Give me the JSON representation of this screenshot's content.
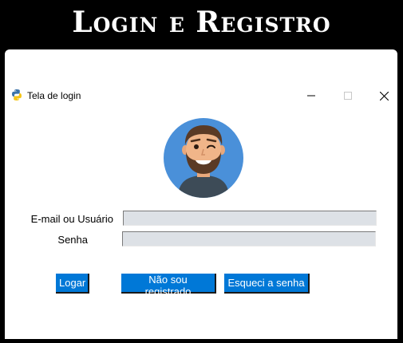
{
  "banner": {
    "title": "Login e Registro"
  },
  "window": {
    "title": "Tela de login",
    "app_icon": "python-icon",
    "controls": {
      "minimize_icon": "minimize-icon",
      "maximize_icon": "maximize-icon",
      "close_icon": "close-icon"
    }
  },
  "avatar": {
    "icon": "user-avatar-winking-bearded-man",
    "background_color": "#4a90d9"
  },
  "form": {
    "user_label": "E-mail ou Usuário",
    "user_value": "",
    "password_label": "Senha",
    "password_value": ""
  },
  "buttons": {
    "login_label": "Logar",
    "register_label": "Não sou registrado",
    "forgot_label": "Esqueci a senha"
  },
  "colors": {
    "button_bg": "#0078d7",
    "field_bg": "#dde1e6",
    "banner_bg": "#000000"
  }
}
